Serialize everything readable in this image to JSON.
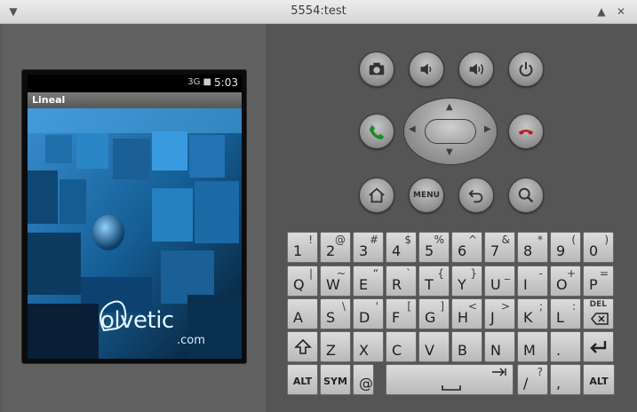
{
  "window": {
    "title": "5554:test"
  },
  "phone": {
    "time": "5:03",
    "status_icons": "3G ■",
    "app_title": "Lineal",
    "watermark": "olvetic",
    "watermark_sub": ".com"
  },
  "controls": {
    "menu_label": "MENU"
  },
  "keyboard": {
    "row1": [
      {
        "main": "1",
        "alt": "!"
      },
      {
        "main": "2",
        "alt": "@"
      },
      {
        "main": "3",
        "alt": "#"
      },
      {
        "main": "4",
        "alt": "$"
      },
      {
        "main": "5",
        "alt": "%"
      },
      {
        "main": "6",
        "alt": "^"
      },
      {
        "main": "7",
        "alt": "&"
      },
      {
        "main": "8",
        "alt": "*"
      },
      {
        "main": "9",
        "alt": "("
      },
      {
        "main": "0",
        "alt": ")"
      }
    ],
    "row2": [
      {
        "main": "Q",
        "alt": "|"
      },
      {
        "main": "W",
        "alt": "~"
      },
      {
        "main": "E",
        "alt": "“"
      },
      {
        "main": "R",
        "alt": "`"
      },
      {
        "main": "T",
        "alt": "{"
      },
      {
        "main": "Y",
        "alt": "}"
      },
      {
        "main": "U",
        "alt": "_"
      },
      {
        "main": "I",
        "alt": "-"
      },
      {
        "main": "O",
        "alt": "+"
      },
      {
        "main": "P",
        "alt": "="
      }
    ],
    "row3": [
      {
        "main": "A",
        "alt": ""
      },
      {
        "main": "S",
        "alt": "\\"
      },
      {
        "main": "D",
        "alt": "'"
      },
      {
        "main": "F",
        "alt": "["
      },
      {
        "main": "G",
        "alt": "]"
      },
      {
        "main": "H",
        "alt": "<"
      },
      {
        "main": "J",
        "alt": ">"
      },
      {
        "main": "K",
        "alt": ";"
      },
      {
        "main": "L",
        "alt": ":"
      }
    ],
    "del_label": "DEL",
    "row4": [
      {
        "main": "Z",
        "alt": ""
      },
      {
        "main": "X",
        "alt": ""
      },
      {
        "main": "C",
        "alt": ""
      },
      {
        "main": "V",
        "alt": ""
      },
      {
        "main": "B",
        "alt": ""
      },
      {
        "main": "N",
        "alt": ""
      },
      {
        "main": "M",
        "alt": ""
      },
      {
        "main": ".",
        "alt": ""
      }
    ],
    "alt_label": "ALT",
    "sym_label": "SYM",
    "at_label": "@",
    "slash_main": "/",
    "slash_alt": "?",
    "comma_main": ","
  }
}
